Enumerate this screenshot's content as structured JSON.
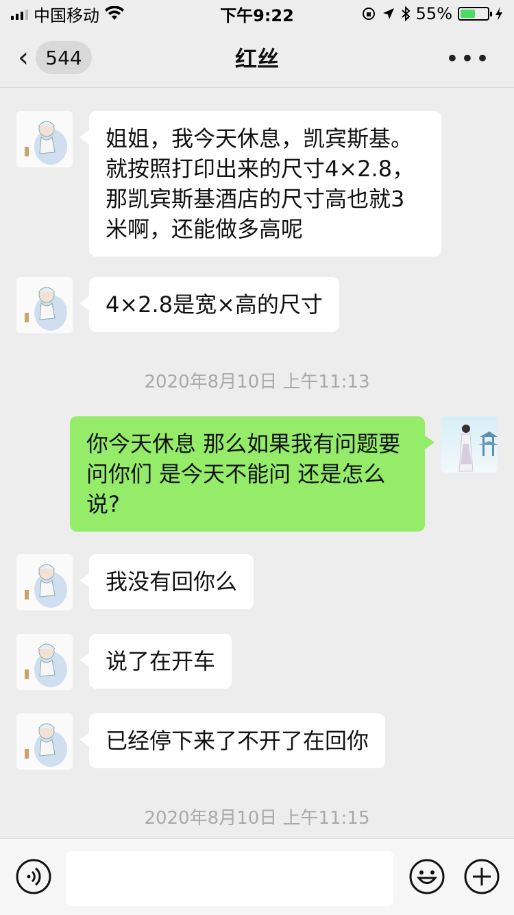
{
  "status_bar": {
    "carrier": "中国移动",
    "time": "下午9:22",
    "battery": "55%"
  },
  "header": {
    "unread_count": "544",
    "title": "红丝",
    "more": "•••"
  },
  "messages": [
    {
      "from": "other",
      "text": "姐姐，我今天休息，凯宾斯基。就按照打印出来的尺寸4×2.8，那凯宾斯基酒店的尺寸高也就3米啊，还能做多高呢"
    },
    {
      "from": "other",
      "text": "4×2.8是宽×高的尺寸"
    },
    {
      "type": "timestamp",
      "text": "2020年8月10日 上午11:13"
    },
    {
      "from": "me",
      "text": "你今天休息 那么如果我有问题要问你们 是今天不能问 还是怎么说?"
    },
    {
      "from": "other",
      "text": "我没有回你么"
    },
    {
      "from": "other",
      "text": "说了在开车"
    },
    {
      "from": "other",
      "text": "已经停下来了不开了在回你"
    },
    {
      "type": "timestamp",
      "text": "2020年8月10日 上午11:15"
    }
  ],
  "input": {
    "value": "",
    "placeholder": ""
  },
  "colors": {
    "background": "#ededed",
    "bubble_in": "#ffffff",
    "bubble_out": "#95ec69",
    "timestamp": "#a9a9a9",
    "battery_fill": "#4cd964"
  },
  "icons": {
    "back": "chevron-left-icon",
    "more": "more-icon",
    "voice": "voice-icon",
    "emoji": "emoji-icon",
    "plus": "plus-icon"
  }
}
